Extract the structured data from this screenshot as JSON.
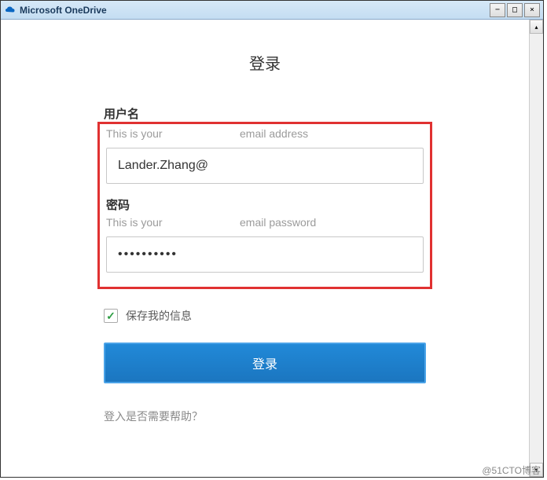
{
  "window": {
    "title": "Microsoft OneDrive"
  },
  "login": {
    "heading": "登录",
    "username_label": "用户名",
    "username_hint_left": "This is your",
    "username_hint_right": "email address",
    "username_value": "Lander.Zhang@",
    "password_label": "密码",
    "password_hint_left": "This is your",
    "password_hint_right": "email password",
    "password_value": "••••••••••",
    "remember_label": "保存我的信息",
    "remember_checked": true,
    "submit_label": "登录",
    "help_link": "登入是否需要帮助？"
  },
  "watermark": "@51CTO博客"
}
